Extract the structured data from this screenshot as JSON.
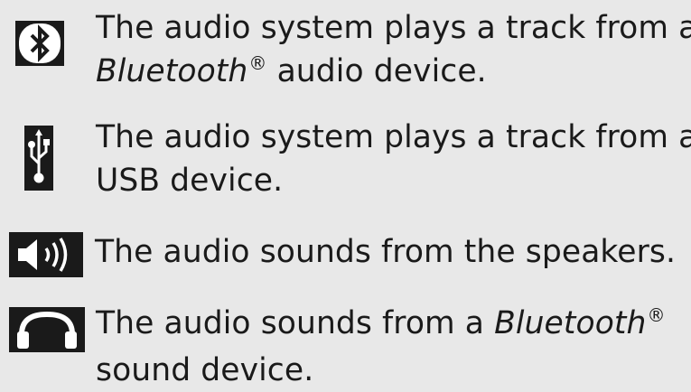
{
  "items": [
    {
      "icon": "bluetooth-icon",
      "line1": "The audio system plays a track from a",
      "line2_italic": "Bluetooth",
      "line2_mark": "®",
      "line2_rest": " audio device."
    },
    {
      "icon": "usb-icon",
      "line1": "The audio system plays a track from a",
      "line2": "USB device."
    },
    {
      "icon": "speaker-icon",
      "line1": "The audio sounds from the speakers."
    },
    {
      "icon": "headphones-icon",
      "line1_plain": "The audio sounds from a ",
      "line1_italic": "Bluetooth",
      "line1_mark": "®",
      "line2": "sound device."
    }
  ]
}
